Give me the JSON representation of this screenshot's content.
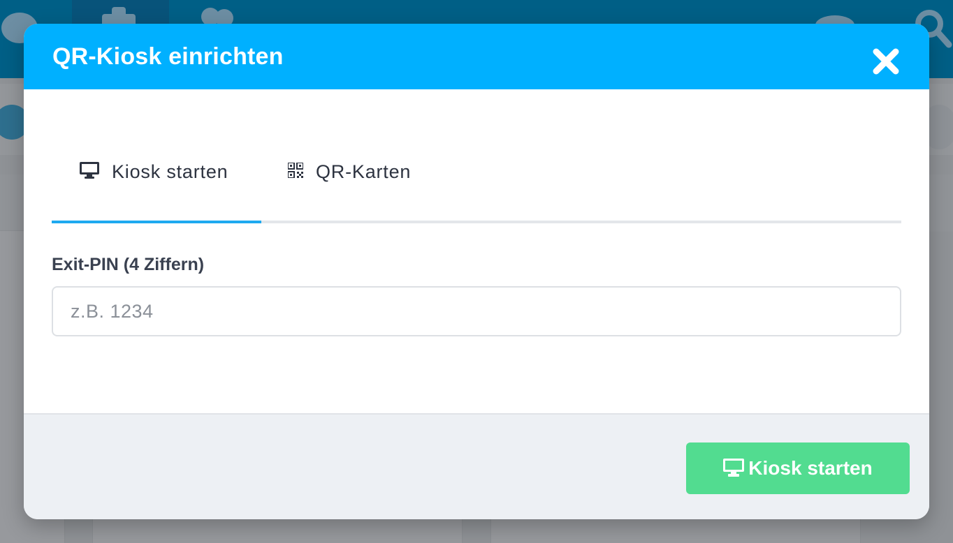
{
  "modal": {
    "title": "QR-Kiosk einrichten",
    "close_icon": "close-icon",
    "tabs": [
      {
        "label": "Kiosk starten",
        "icon": "monitor-icon",
        "active": true
      },
      {
        "label": "QR-Karten",
        "icon": "qrcode-icon",
        "active": false
      }
    ],
    "pin_field": {
      "label": "Exit-PIN (4 Ziffern)",
      "placeholder": "z.B. 1234",
      "value": ""
    },
    "footer": {
      "start_button": {
        "label": "Kiosk starten",
        "icon": "monitor-icon"
      }
    }
  },
  "colors": {
    "header": "#00b0ff",
    "active_tab_underline": "#1ea9f0",
    "start_button": "#52dc90",
    "footer_bg": "#edf0f4"
  }
}
